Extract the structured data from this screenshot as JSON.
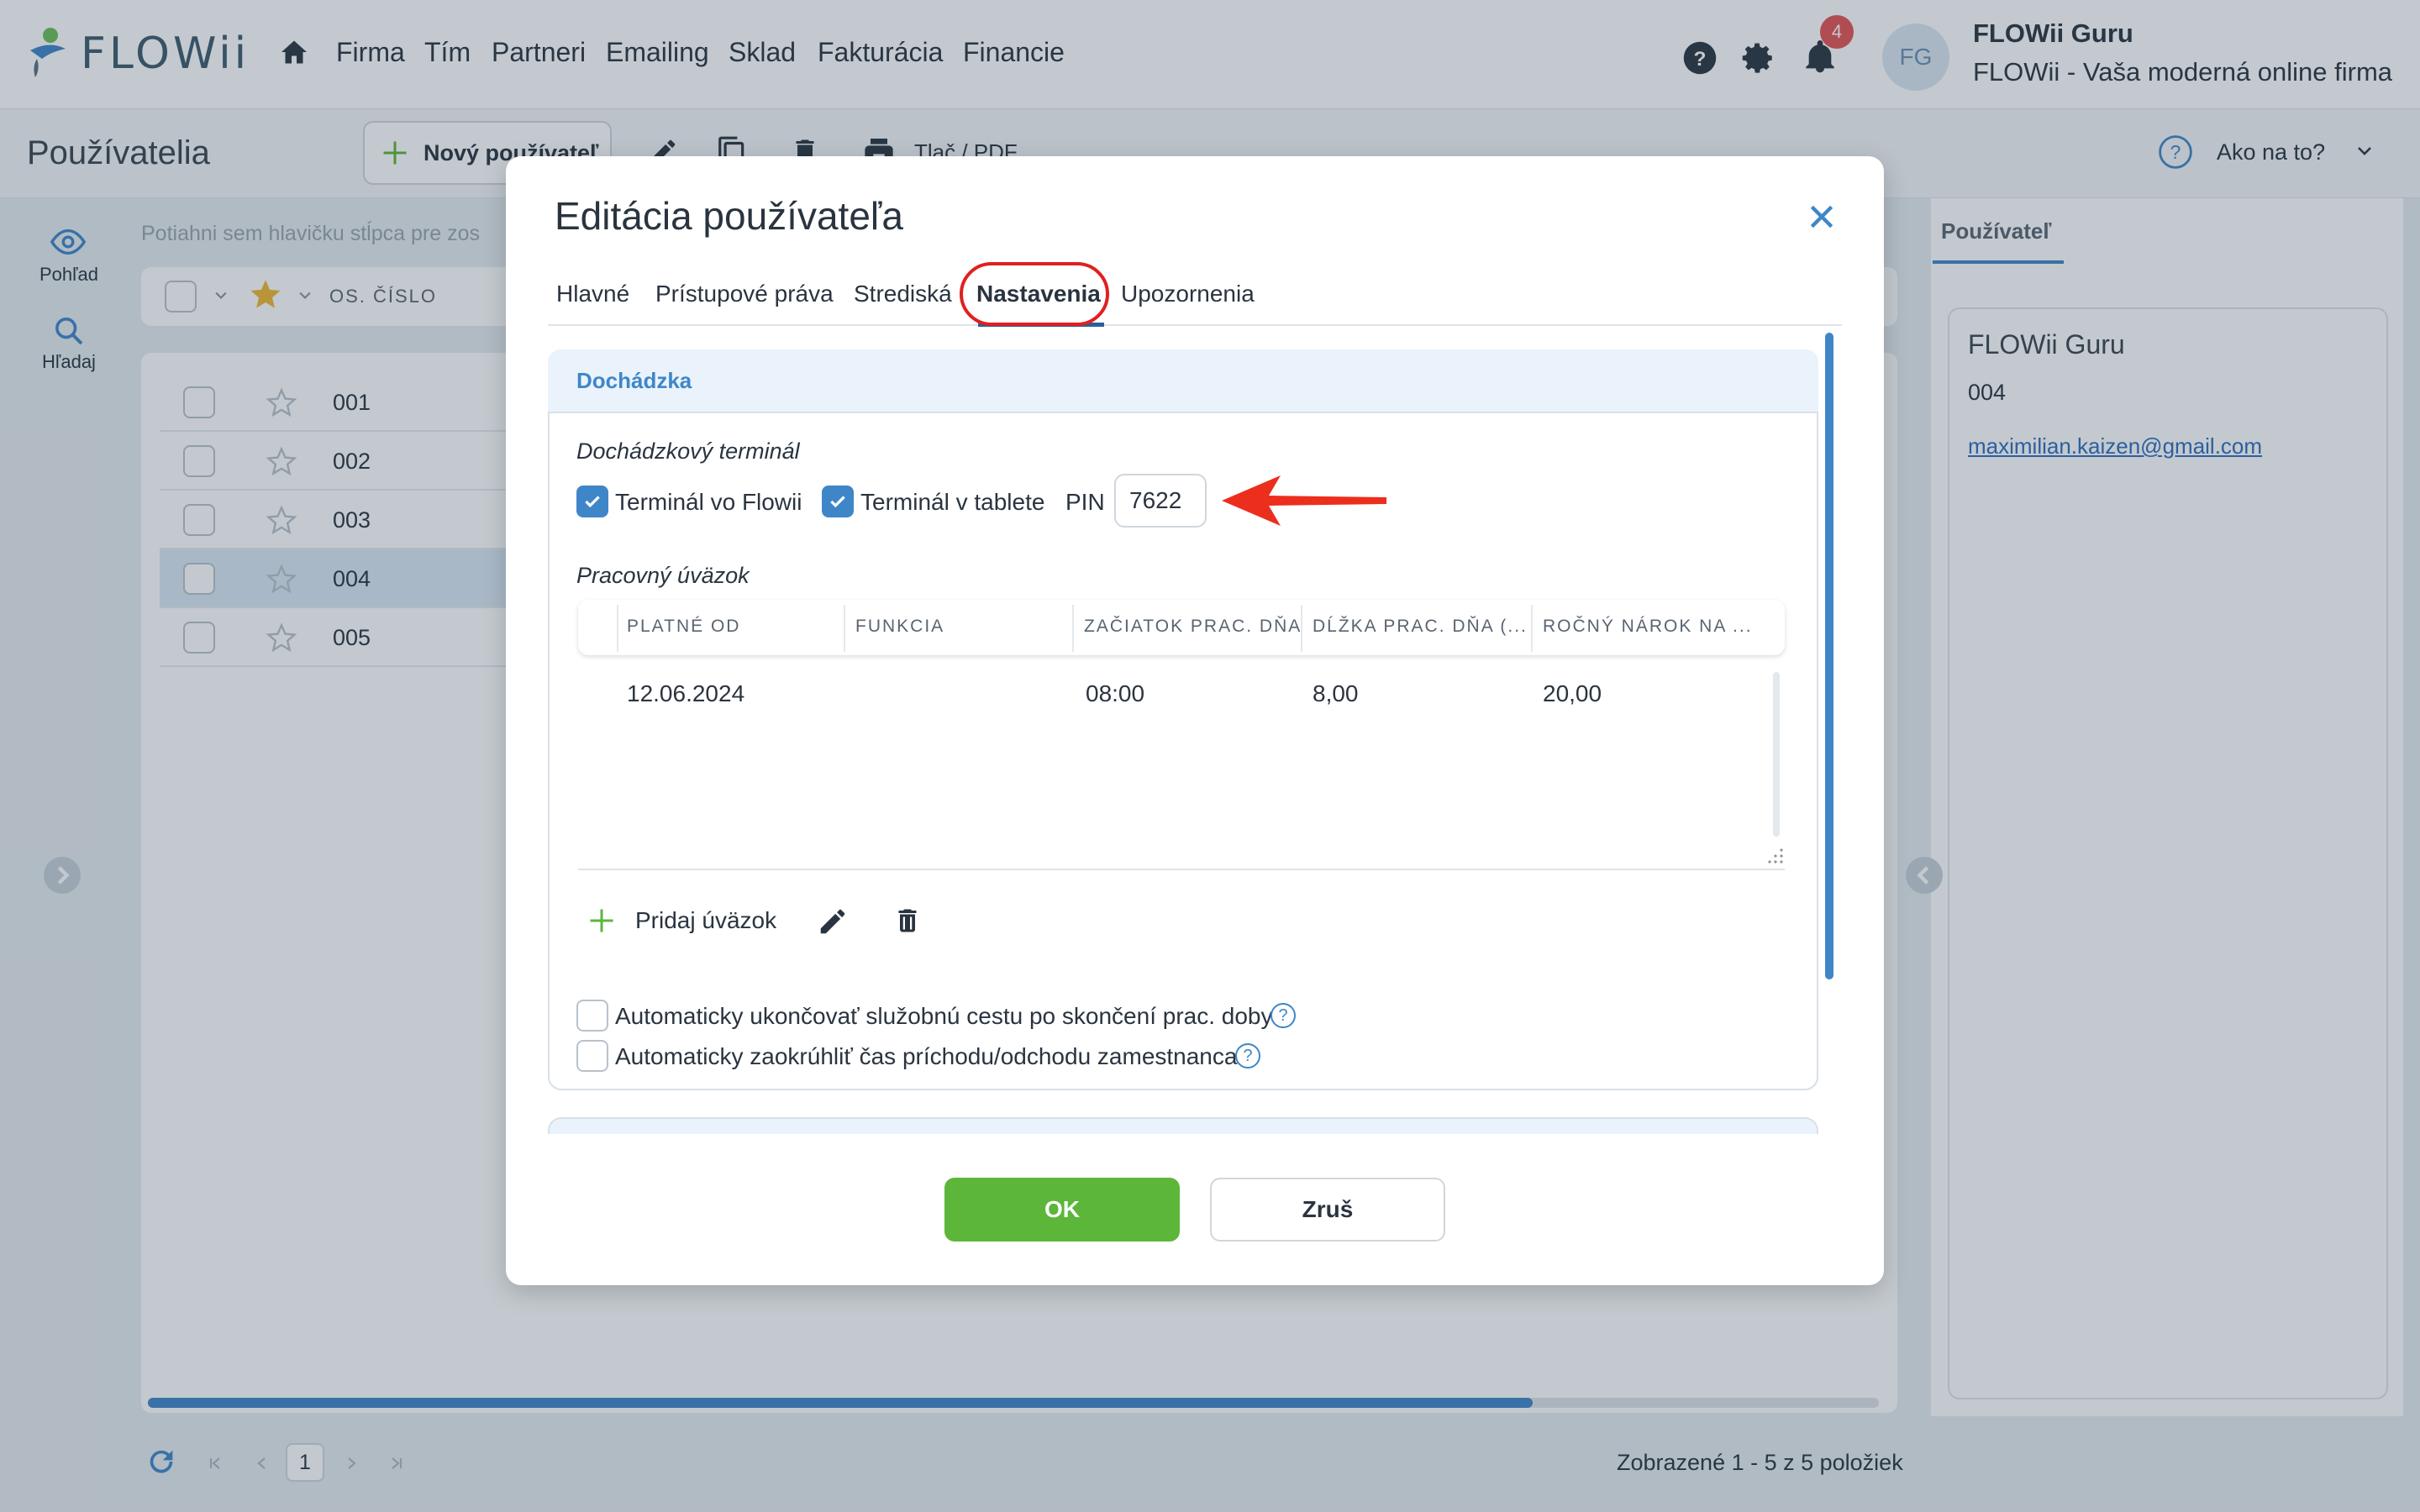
{
  "app": {
    "logo_text": "FLOWii",
    "nav": [
      "Firma",
      "Tím",
      "Partneri",
      "Emailing",
      "Sklad",
      "Fakturácia",
      "Financie"
    ],
    "notification_count": "4",
    "avatar_initials": "FG",
    "user_name": "FLOWii Guru",
    "user_company": "FLOWii - Vaša moderná online firma"
  },
  "toolbar": {
    "page_title": "Používatelia",
    "new_user_label": "Nový používateľ",
    "print_label": "Tlač / PDF",
    "help_label": "Ako na to?"
  },
  "sidebar": {
    "view_label": "Pohľad",
    "search_label": "Hľadaj"
  },
  "grid": {
    "drag_hint": "Potiahni sem hlavičku stĺpca pre zos",
    "column_os_cislo": "OS. ČÍSLO",
    "rows": [
      "001",
      "002",
      "003",
      "004",
      "005"
    ],
    "selected_row": "004",
    "page": "1",
    "footer_count": "Zobrazené 1 - 5 z 5 položiek",
    "horizontal_scroll_fraction": 0.8
  },
  "right_panel": {
    "tab_label": "Používateľ",
    "name": "FLOWii Guru",
    "number": "004",
    "email": "maximilian.kaizen@gmail.com"
  },
  "modal": {
    "title": "Editácia používateľa",
    "tabs": [
      "Hlavné",
      "Prístupové práva",
      "Strediská",
      "Nastavenia",
      "Upozornenia"
    ],
    "active_tab": "Nastavenia",
    "section_title": "Dochádzka",
    "terminal_heading": "Dochádzkový terminál",
    "terminal_flowii_label": "Terminál vo Flowii",
    "terminal_flowii_checked": true,
    "terminal_tablet_label": "Terminál v tablete",
    "terminal_tablet_checked": true,
    "pin_label": "PIN",
    "pin_value": "7622",
    "workload_heading": "Pracovný úväzok",
    "workload_columns": [
      "PLATNÉ OD",
      "FUNKCIA",
      "ZAČIATOK PRAC. DŇA",
      "DĹŽKA PRAC. DŇA (...",
      "ROČNÝ NÁROK NA ..."
    ],
    "workload_rows": [
      {
        "platne_od": "12.06.2024",
        "funkcia": "",
        "zaciatok": "08:00",
        "dlzka": "8,00",
        "narok": "20,00"
      }
    ],
    "add_workload_label": "Pridaj úväzok",
    "auto_end_trip_label": "Automaticky ukončovať služobnú cestu po skončení prac. doby",
    "auto_round_label": "Automaticky zaokrúhliť čas príchodu/odchodu zamestnanca",
    "ok_label": "OK",
    "cancel_label": "Zruš"
  },
  "colors": {
    "accent_blue": "#3f86c9",
    "ok_green": "#5cb63a",
    "highlight_red": "#e02020",
    "badge_red": "#e35454"
  }
}
